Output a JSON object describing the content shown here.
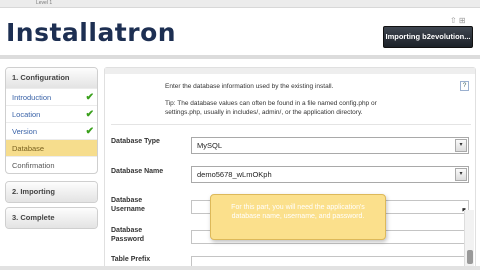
{
  "window": {
    "top_label": "Level 1"
  },
  "app": {
    "logo": "Installatron",
    "tools_glyph": "⇧ ⊞",
    "importing_label": "Importing b2evolution..."
  },
  "sidebar": {
    "config_header": "1. Configuration",
    "items": [
      {
        "label": "Introduction",
        "check": "✔"
      },
      {
        "label": "Location",
        "check": "✔"
      },
      {
        "label": "Version",
        "check": "✔"
      },
      {
        "label": "Database",
        "check": ""
      },
      {
        "label": "Confirmation",
        "check": ""
      }
    ],
    "importing_header": "2. Importing",
    "complete_header": "3. Complete"
  },
  "main": {
    "intro": "Enter the database information used by the existing install.",
    "help_icon": "?",
    "tip": "Tip: The database values can often be found in a file named config.php or settings.php, usually in includes/, admin/, or the application directory.",
    "fields": {
      "db_type_label": "Database Type",
      "db_type_value": "MySQL",
      "db_name_label": "Database Name",
      "db_name_value": "demo5678_wLmOKph",
      "db_user_label": "Database Username",
      "db_pass_label": "Database Password",
      "table_prefix_label": "Table Prefix"
    },
    "select_arrow": "▾"
  },
  "tooltip": {
    "text": "For this part, you will need the application's database name, username, and password."
  },
  "cursor_glyph": "⬉"
}
